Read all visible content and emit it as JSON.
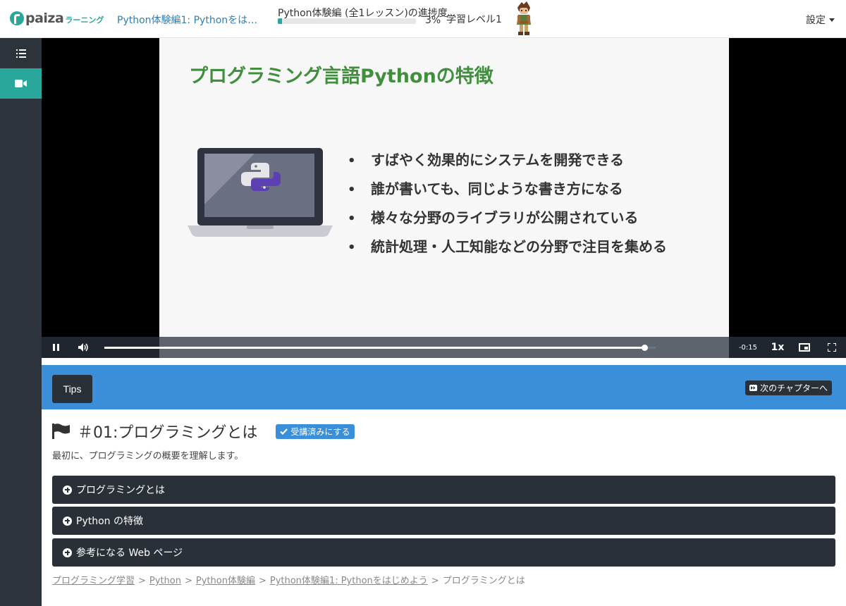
{
  "header": {
    "logo_text": "paiza",
    "logo_sub": "ラーニング",
    "lesson_link": "Python体験編1: Pythonをは…",
    "progress_title": "Python体験編 (全1レッスン)の進捗度",
    "progress_value": 3,
    "progress_pct_label": "3%",
    "level_label": "学習レベル1",
    "settings_label": "設定",
    "accent_color": "#2aa79b"
  },
  "sidebar": {
    "items": [
      {
        "icon": "list-icon"
      },
      {
        "icon": "video-camera-icon",
        "active": true
      }
    ]
  },
  "video": {
    "slide": {
      "title": "プログラミング言語Pythonの特徴",
      "bullets": [
        "すばやく効果的にシステムを開発できる",
        "誰が書いても、同じような書き方になる",
        "様々な分野のライブラリが公開されている",
        "統計処理・人工知能などの分野で注目を集める"
      ]
    },
    "playback_progress": 0.98,
    "time_remaining": "-0:15",
    "speed": "1x"
  },
  "toolbar": {
    "tips_label": "Tips",
    "next_label": "次のチャプターへ",
    "bg_color": "#3a8fd8"
  },
  "chapter": {
    "title": "＃01:プログラミングとは",
    "done_label": "受講済みにする",
    "description": "最初に、プログラミングの概要を理解します。"
  },
  "accordions": [
    {
      "label": "プログラミングとは"
    },
    {
      "label": "Python の特徴"
    },
    {
      "label": "参考になる Web ページ"
    }
  ],
  "breadcrumb": {
    "links": [
      "プログラミング学習",
      "Python",
      "Python体験編",
      "Python体験編1: Pythonをはじめよう"
    ],
    "current": "プログラミングとは",
    "separator": ">"
  }
}
